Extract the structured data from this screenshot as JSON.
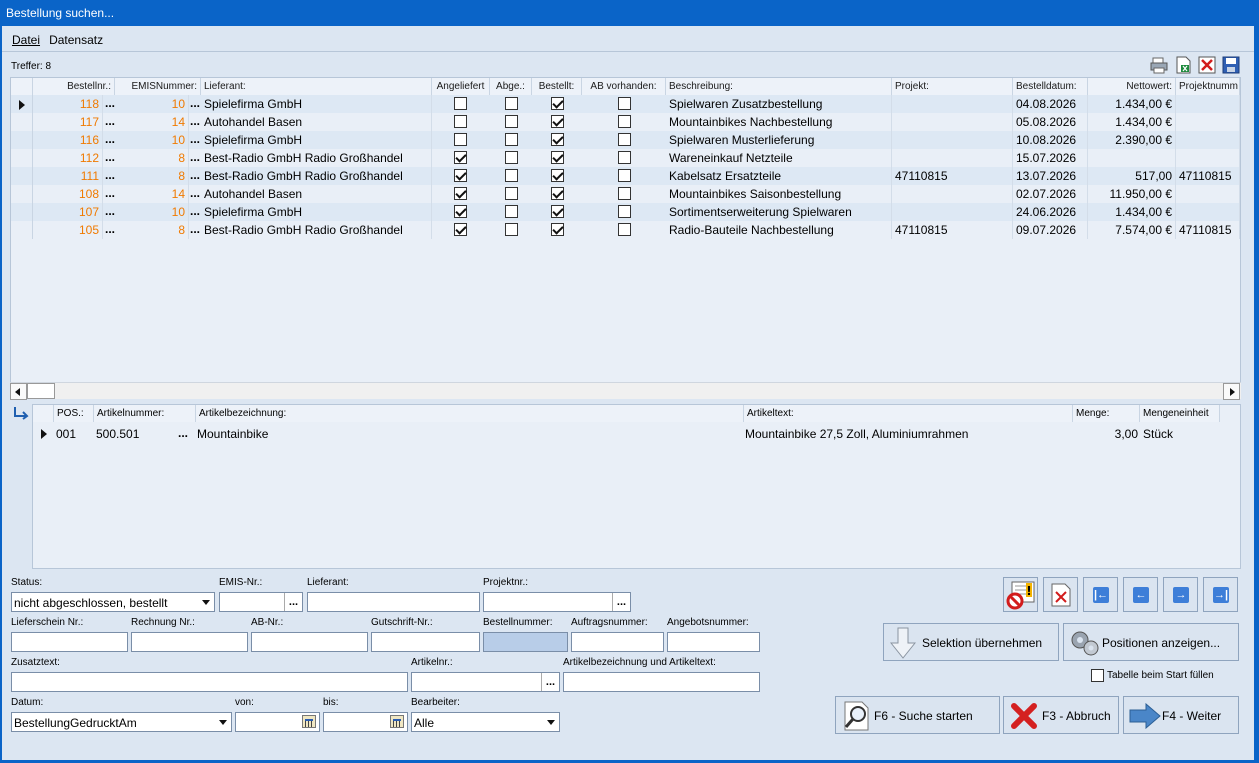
{
  "window": {
    "title": "Bestellung suchen..."
  },
  "menu": {
    "datei": "Datei",
    "datensatz": "Datensatz"
  },
  "treffer": "Treffer: 8",
  "grid": {
    "headers": {
      "bestellnr": "Bestellnr.:",
      "emisnr": "EMISNummer:",
      "lieferant": "Lieferant:",
      "angeliefert": "Angeliefert",
      "abge": "Abge.:",
      "bestellt": "Bestellt:",
      "ab": "AB vorhanden:",
      "beschreibung": "Beschreibung:",
      "projekt": "Projekt:",
      "datum": "Bestelldatum:",
      "netto": "Nettowert:",
      "projektnr": "Projektnumm"
    },
    "rows": [
      {
        "bestellnr": "118",
        "emis": "10",
        "lieferant": "Spielefirma GmbH",
        "angeliefert": false,
        "abge": false,
        "bestellt": true,
        "ab": false,
        "beschreibung": "Spielwaren Zusatzbestellung",
        "projekt": "",
        "datum": "04.08.2026",
        "netto": "1.434,00 €",
        "projektnr": ""
      },
      {
        "bestellnr": "117",
        "emis": "14",
        "lieferant": "Autohandel Basen",
        "angeliefert": false,
        "abge": false,
        "bestellt": true,
        "ab": false,
        "beschreibung": "Mountainbikes Nachbestellung",
        "projekt": "",
        "datum": "05.08.2026",
        "netto": "1.434,00 €",
        "projektnr": ""
      },
      {
        "bestellnr": "116",
        "emis": "10",
        "lieferant": "Spielefirma GmbH",
        "angeliefert": false,
        "abge": false,
        "bestellt": true,
        "ab": false,
        "beschreibung": "Spielwaren Musterlieferung",
        "projekt": "",
        "datum": "10.08.2026",
        "netto": "2.390,00 €",
        "projektnr": ""
      },
      {
        "bestellnr": "112",
        "emis": "8",
        "lieferant": "Best-Radio GmbH Radio Großhandel",
        "angeliefert": true,
        "abge": false,
        "bestellt": true,
        "ab": false,
        "beschreibung": "Wareneinkauf Netzteile",
        "projekt": "",
        "datum": "15.07.2026",
        "netto": "",
        "projektnr": ""
      },
      {
        "bestellnr": "111",
        "emis": "8",
        "lieferant": "Best-Radio GmbH Radio Großhandel",
        "angeliefert": true,
        "abge": false,
        "bestellt": true,
        "ab": false,
        "beschreibung": "Kabelsatz Ersatzteile",
        "projekt": "47110815",
        "datum": "13.07.2026",
        "netto": "517,00",
        "projektnr": "47110815"
      },
      {
        "bestellnr": "108",
        "emis": "14",
        "lieferant": "Autohandel Basen",
        "angeliefert": true,
        "abge": false,
        "bestellt": true,
        "ab": false,
        "beschreibung": "Mountainbikes Saisonbestellung",
        "projekt": "",
        "datum": "02.07.2026",
        "netto": "11.950,00 €",
        "projektnr": ""
      },
      {
        "bestellnr": "107",
        "emis": "10",
        "lieferant": "Spielefirma GmbH",
        "angeliefert": true,
        "abge": false,
        "bestellt": true,
        "ab": false,
        "beschreibung": "Sortimentserweiterung Spielwaren",
        "projekt": "",
        "datum": "24.06.2026",
        "netto": "1.434,00 €",
        "projektnr": ""
      },
      {
        "bestellnr": "105",
        "emis": "8",
        "lieferant": "Best-Radio GmbH Radio Großhandel",
        "angeliefert": true,
        "abge": false,
        "bestellt": true,
        "ab": false,
        "beschreibung": "Radio-Bauteile Nachbestellung",
        "projekt": "47110815",
        "datum": "09.07.2026",
        "netto": "7.574,00 €",
        "projektnr": "47110815"
      }
    ],
    "ellipsis": "..."
  },
  "detail": {
    "headers": {
      "pos": "POS.:",
      "artikelnr": "Artikelnummer:",
      "bezeichnung": "Artikelbezeichnung:",
      "text": "Artikeltext:",
      "menge": "Menge:",
      "einheit": "Mengeneinheit"
    },
    "row": {
      "pos": "001",
      "artikelnr": "500.501",
      "bezeichnung": "Mountainbike",
      "text": "Mountainbike 27,5 Zoll, Aluminiumrahmen",
      "menge": "3,00",
      "einheit": "Stück"
    }
  },
  "form": {
    "status_label": "Status:",
    "status_value": "nicht abgeschlossen, bestellt",
    "emis_label": "EMIS-Nr.:",
    "lieferant_label": "Lieferant:",
    "projektnr_label": "Projektnr.:",
    "lieferschein_label": "Lieferschein Nr.:",
    "rechnung_label": "Rechnung Nr.:",
    "ab_label": "AB-Nr.:",
    "gutschrift_label": "Gutschrift-Nr.:",
    "bestellnummer_label": "Bestellnummer:",
    "auftrag_label": "Auftragsnummer:",
    "angebot_label": "Angebotsnummer:",
    "zusatz_label": "Zusatztext:",
    "artikelnr_label": "Artikelnr.:",
    "artbez_label": "Artikelbezeichnung und Artikeltext:",
    "datum_label": "Datum:",
    "datum_value": "BestellungGedrucktAm",
    "von_label": "von:",
    "bis_label": "bis:",
    "bearbeiter_label": "Bearbeiter:",
    "bearbeiter_value": "Alle",
    "dots": "..."
  },
  "buttons": {
    "selektion": "Selektion übernehmen",
    "positionen": "Positionen anzeigen...",
    "tabelle": "Tabelle beim Start füllen",
    "suche": "F6 - Suche starten",
    "abbruch": "F3 - Abbruch",
    "weiter": "F4 - Weiter"
  },
  "colors": {
    "titlebar": "#0a64c8",
    "background": "#dce6f2",
    "number": "#f07a00",
    "highlight": "#b8cde8"
  }
}
